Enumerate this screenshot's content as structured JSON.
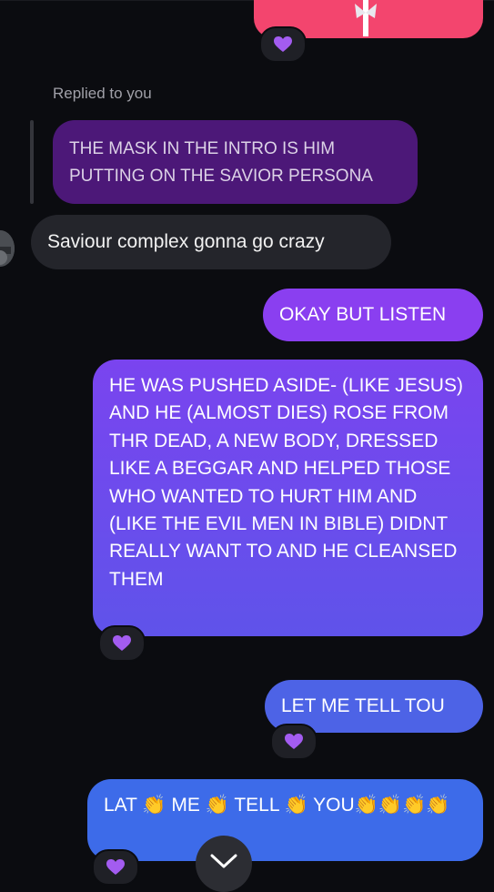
{
  "colors": {
    "background": "#0b0c10",
    "gift": "#f3456e",
    "quoted_bubble": "#4c1878",
    "incoming_bubble": "#24252b",
    "outgoing_purple": "#8a3ff0",
    "outgoing_violet_gradient": [
      "#7a44ef",
      "#5f53ea"
    ],
    "outgoing_indigo": "#4d63e6",
    "outgoing_blue": "#3d6be9",
    "reaction": "#a35cf0"
  },
  "reply": {
    "label": "Replied to you",
    "quoted_text": "THE MASK IN THE INTRO IS HIM PUTTING ON THE SAVIOR PERSONA",
    "message": "Saviour complex gonna go crazy"
  },
  "messages": [
    {
      "text": "OKAY BUT LISTEN",
      "reaction_icon": ""
    },
    {
      "text": "HE WAS PUSHED ASIDE- (LIKE JESUS) AND HE (ALMOST DIES) ROSE FROM THR DEAD, A NEW BODY, DRESSED LIKE A BEGGAR AND HELPED THOSE WHO WANTED TO HURT HIM AND (LIKE THE EVIL MEN IN BIBLE) DIDNT REALLY WANT TO AND HE CLEANSED THEM",
      "reaction_icon": "purple-heart-icon"
    },
    {
      "text": "LET ME TELL TOU",
      "reaction_icon": "purple-heart-icon"
    },
    {
      "text": "LAT 👏 ME 👏 TELL 👏 YOU👏👏👏👏",
      "reaction_icon": "purple-heart-icon"
    }
  ],
  "icons": {
    "gift": "gift-ribbon-icon",
    "scroll": "chevron-down-icon"
  }
}
